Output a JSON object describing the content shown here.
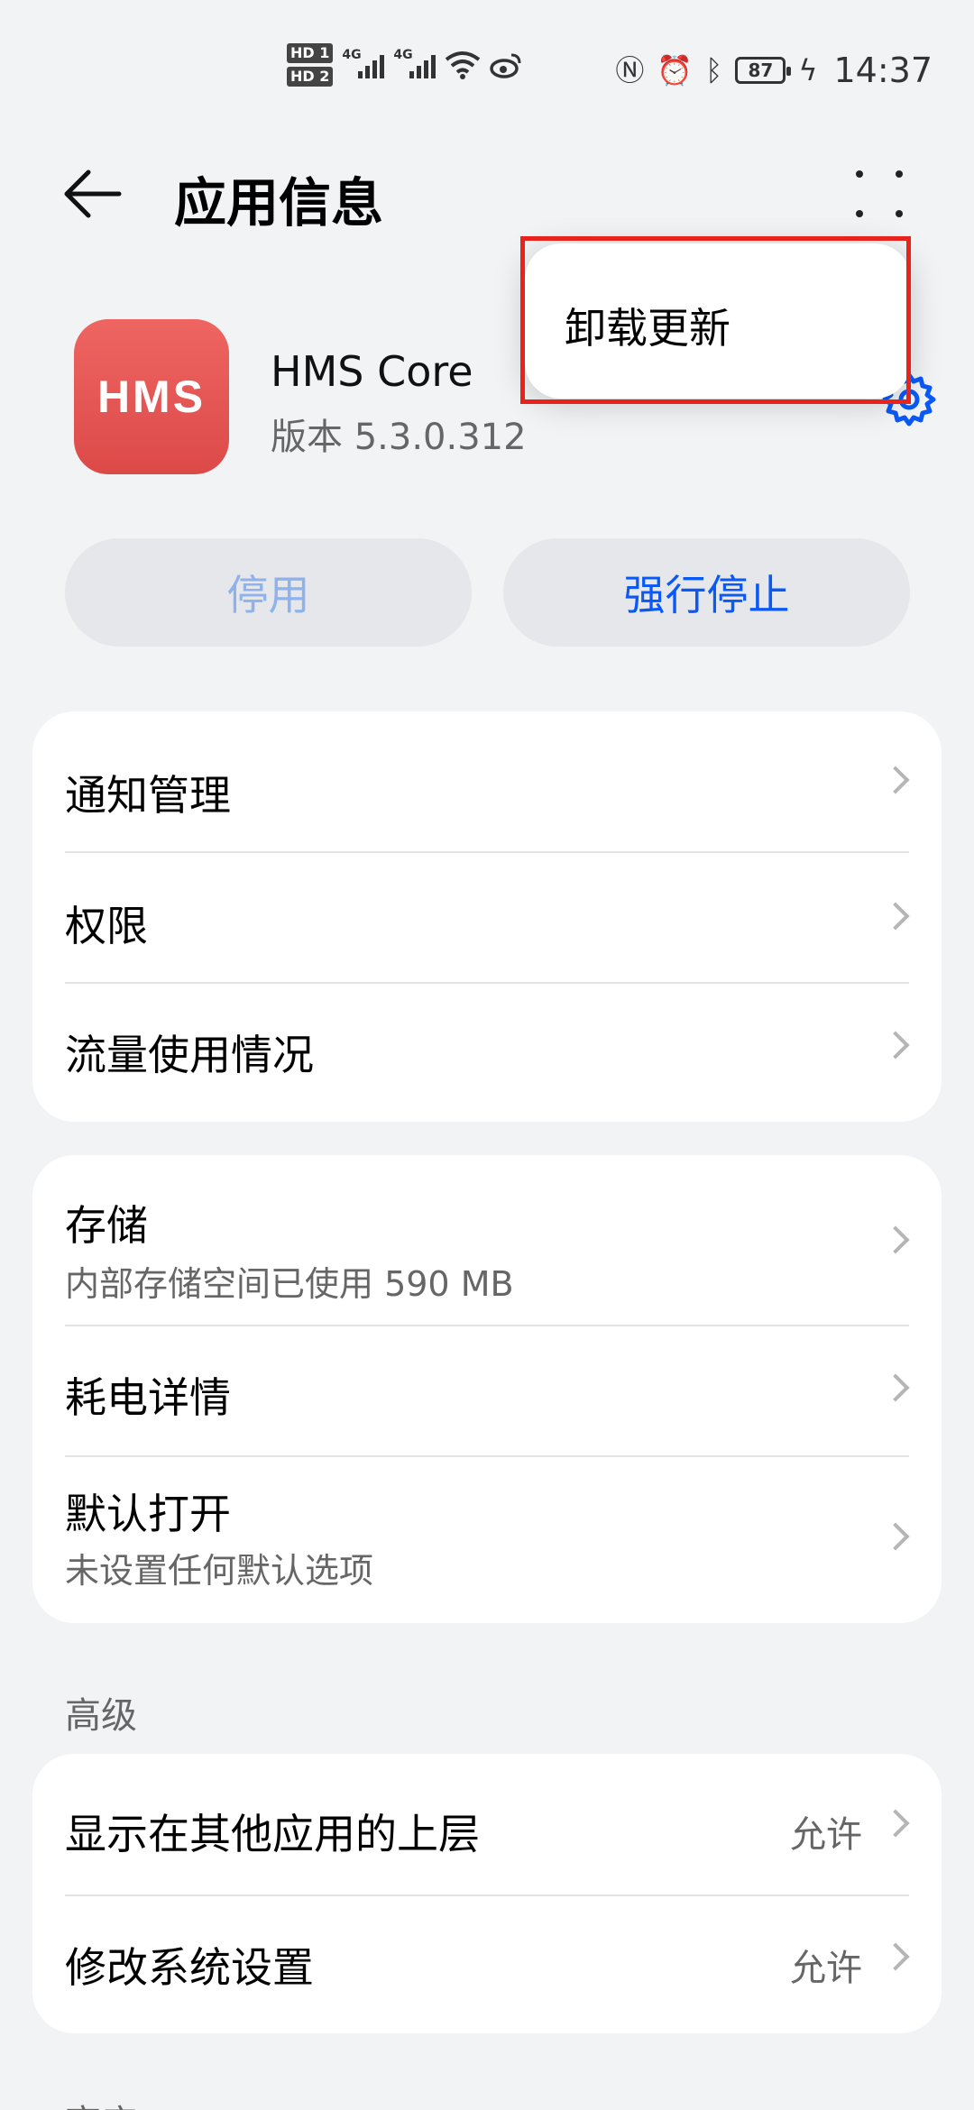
{
  "status_bar": {
    "hd1": "HD 1",
    "hd2": "HD 2",
    "network1": "4G",
    "network2": "4G",
    "battery": "87",
    "time": "14:37",
    "icons": [
      "nfc-icon",
      "alarm-icon",
      "bluetooth-icon",
      "charging-icon",
      "wifi-icon",
      "weibo-icon"
    ]
  },
  "header": {
    "title": "应用信息"
  },
  "app": {
    "icon_text": "HMS",
    "name": "HMS Core",
    "version": "版本 5.3.0.312",
    "icon_color": "#e15452"
  },
  "actions": {
    "disable_label": "停用",
    "force_stop_label": "强行停止"
  },
  "popup_menu": {
    "items": [
      "卸载更新"
    ]
  },
  "group1": {
    "items": [
      {
        "title": "通知管理"
      },
      {
        "title": "权限"
      },
      {
        "title": "流量使用情况"
      }
    ]
  },
  "group2": {
    "items": [
      {
        "title": "存储",
        "subtitle": "内部存储空间已使用 590 MB"
      },
      {
        "title": "耗电详情"
      },
      {
        "title": "默认打开",
        "subtitle": "未设置任何默认选项"
      }
    ]
  },
  "advanced": {
    "header": "高级",
    "items": [
      {
        "title": "显示在其他应用的上层",
        "value": "允许"
      },
      {
        "title": "修改系统设置",
        "value": "允许"
      }
    ]
  },
  "next_section_header": "商店",
  "colors": {
    "accent": "#0a59f7",
    "disabled_text": "#8fb2ea",
    "highlight": "#e8231c",
    "background": "#f1f3f5"
  }
}
